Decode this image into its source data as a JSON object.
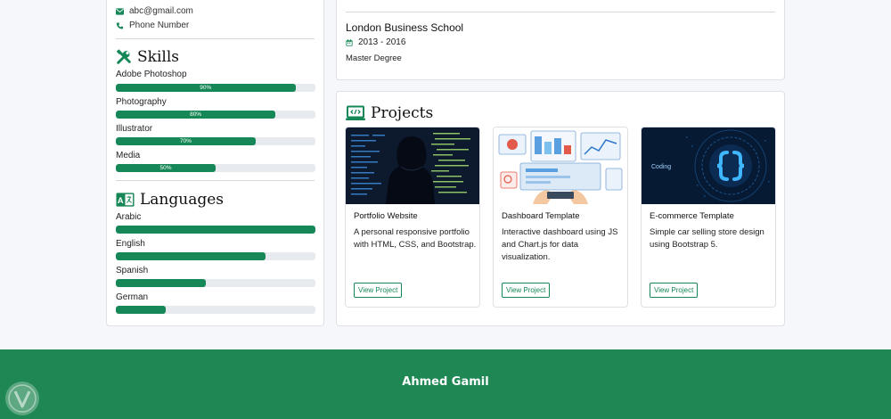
{
  "contact": {
    "email": "abc@gmail.com",
    "phone": "Phone Number"
  },
  "skills": {
    "title": "Skills",
    "items": [
      {
        "name": "Adobe Photoshop",
        "percent": 90,
        "label": "90%"
      },
      {
        "name": "Photography",
        "percent": 80,
        "label": "80%"
      },
      {
        "name": "Illustrator",
        "percent": 70,
        "label": "70%"
      },
      {
        "name": "Media",
        "percent": 50,
        "label": "50%"
      }
    ]
  },
  "languages": {
    "title": "Languages",
    "items": [
      {
        "name": "Arabic",
        "percent": 100
      },
      {
        "name": "English",
        "percent": 75
      },
      {
        "name": "Spanish",
        "percent": 45
      },
      {
        "name": "German",
        "percent": 25
      }
    ]
  },
  "education": {
    "school": "London Business School",
    "years": "2013 - 2016",
    "degree": "Master Degree"
  },
  "projects": {
    "title": "Projects",
    "items": [
      {
        "title": "Portfolio Website",
        "description": "A personal responsive portfolio with HTML, CSS, and Bootstrap.",
        "button": "View Project"
      },
      {
        "title": "Dashboard Template",
        "description": "Interactive dashboard using JS and Chart.js for data visualization.",
        "button": "View Project"
      },
      {
        "title": "E-commerce Template",
        "description": "Simple car selling store design using Bootstrap 5.",
        "button": "View Project",
        "image_text": "Coding"
      }
    ]
  },
  "footer": {
    "name": "Ahmed Gamil"
  },
  "colors": {
    "accent": "#168756",
    "footer": "#1f8754",
    "track": "#e7eaee"
  }
}
